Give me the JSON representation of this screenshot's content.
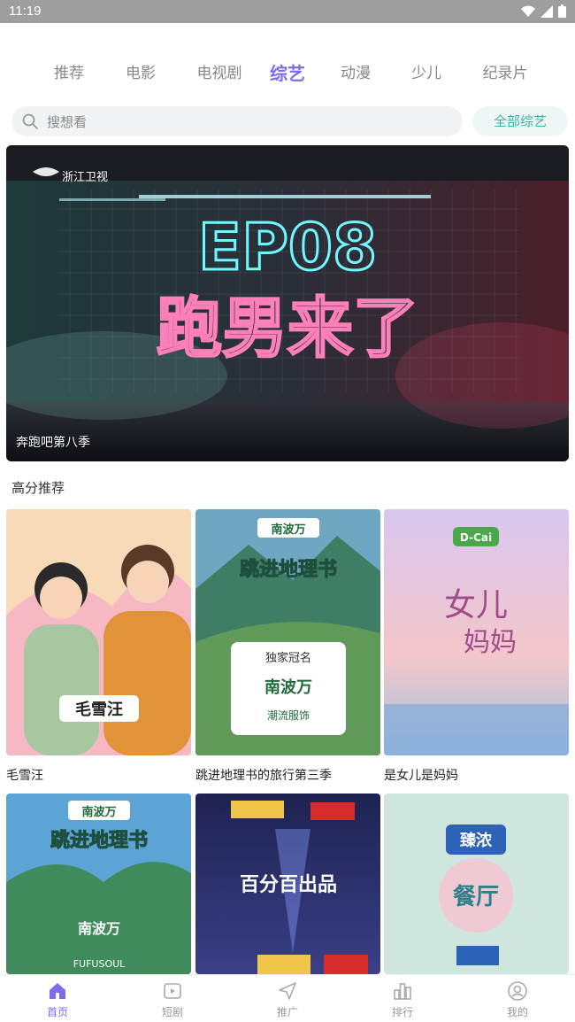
{
  "status_bar": {
    "time": "11:19"
  },
  "tabs": [
    {
      "label": "推荐",
      "active": false
    },
    {
      "label": "电影",
      "active": false
    },
    {
      "label": "电视剧",
      "active": false
    },
    {
      "label": "综艺",
      "active": true
    },
    {
      "label": "动漫",
      "active": false
    },
    {
      "label": "少儿",
      "active": false
    },
    {
      "label": "纪录片",
      "active": false
    }
  ],
  "search": {
    "placeholder": "搜想看",
    "all_button": "全部综艺"
  },
  "banner": {
    "channel_logo": "浙江卫视",
    "headline_top": "EP08",
    "headline_bottom": "跑男来了",
    "caption": "奔跑吧第八季"
  },
  "section": {
    "title": "高分推荐"
  },
  "cards": [
    {
      "title": "毛雪汪",
      "poster_text": "毛雪汪",
      "color": "#f6b9c4"
    },
    {
      "title": "跳进地理书的旅行第三季",
      "poster_text": "南波万",
      "color": "#4d8c6a"
    },
    {
      "title": "是女儿是妈妈",
      "poster_text": "D-Cai",
      "color": "#c9b6e4"
    },
    {
      "title": "",
      "poster_text": "南波万",
      "color": "#3a6fb0"
    },
    {
      "title": "",
      "poster_text": "百分百出品",
      "color": "#2b2f6a"
    },
    {
      "title": "",
      "poster_text": "臻浓",
      "color": "#cfe6de"
    }
  ],
  "bottom_nav": [
    {
      "label": "首页",
      "icon": "home-icon",
      "active": true
    },
    {
      "label": "短剧",
      "icon": "play-icon",
      "active": false
    },
    {
      "label": "推广",
      "icon": "send-icon",
      "active": false
    },
    {
      "label": "排行",
      "icon": "chart-icon",
      "active": false
    },
    {
      "label": "我的",
      "icon": "user-icon",
      "active": false
    }
  ],
  "colors": {
    "accent": "#7b6cf0",
    "teal": "#37b4a8"
  }
}
